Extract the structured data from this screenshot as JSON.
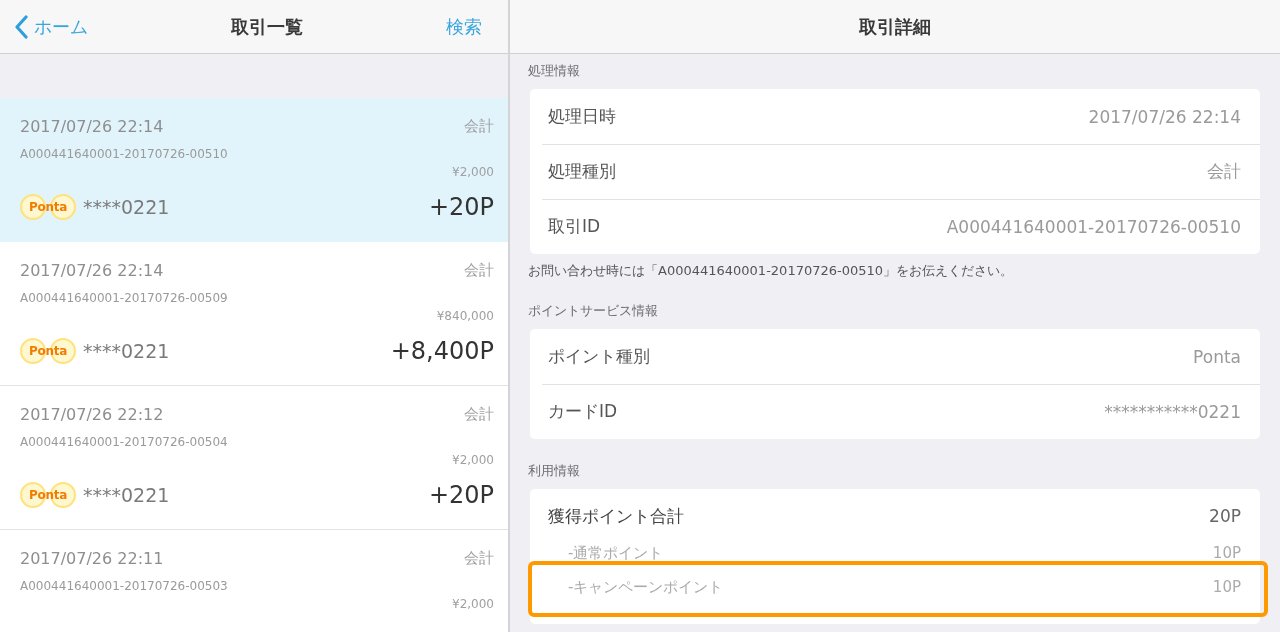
{
  "list_nav": {
    "back": "ホーム",
    "title": "取引一覧",
    "action": "検索"
  },
  "transactions": [
    {
      "datetime": "2017/07/26 22:14",
      "type": "会計",
      "id": "A000441640001-20170726-00510",
      "amount": "¥2,000",
      "brand": "Ponta",
      "card": "****0221",
      "points": "+20P",
      "selected": true
    },
    {
      "datetime": "2017/07/26 22:14",
      "type": "会計",
      "id": "A000441640001-20170726-00509",
      "amount": "¥840,000",
      "brand": "Ponta",
      "card": "****0221",
      "points": "+8,400P",
      "selected": false
    },
    {
      "datetime": "2017/07/26 22:12",
      "type": "会計",
      "id": "A000441640001-20170726-00504",
      "amount": "¥2,000",
      "brand": "Ponta",
      "card": "****0221",
      "points": "+20P",
      "selected": false
    },
    {
      "datetime": "2017/07/26 22:11",
      "type": "会計",
      "id": "A000441640001-20170726-00503",
      "amount": "¥2,000",
      "selected": false
    }
  ],
  "detail_nav": {
    "title": "取引詳細"
  },
  "sections": [
    {
      "header": "処理情報",
      "rows": [
        {
          "kind": "field",
          "label": "処理日時",
          "value": "2017/07/26 22:14"
        },
        {
          "kind": "field",
          "label": "処理種別",
          "value": "会計"
        },
        {
          "kind": "field",
          "label": "取引ID",
          "value": "A000441640001-20170726-00510"
        }
      ],
      "note": "お問い合わせ時には「A000441640001-20170726-00510」をお伝えください。"
    },
    {
      "header": "ポイントサービス情報",
      "rows": [
        {
          "kind": "field",
          "label": "ポイント種別",
          "value": "Ponta"
        },
        {
          "kind": "field",
          "label": "カードID",
          "value": "***********0221"
        }
      ]
    },
    {
      "header": "利用情報",
      "rows": [
        {
          "kind": "total",
          "label": "獲得ポイント合計",
          "value": "20P",
          "highlighted": false
        },
        {
          "kind": "sub",
          "label": "-通常ポイント",
          "value": "10P",
          "highlighted": false
        },
        {
          "kind": "sub",
          "label": "-キャンペーンポイント",
          "value": "10P",
          "highlighted": true
        }
      ]
    }
  ]
}
